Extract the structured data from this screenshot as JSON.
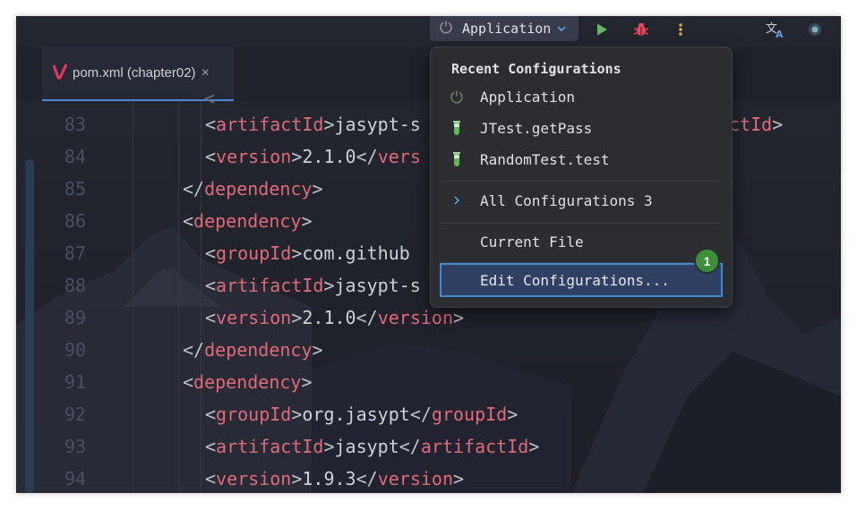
{
  "toolbar": {
    "run_config_label": "Application",
    "icons": [
      "power-icon",
      "chevron-down-icon",
      "run-icon",
      "debug-icon",
      "more-icon",
      "translate-icon",
      "status-icon"
    ]
  },
  "tab": {
    "title": "pom.xml (chapter02)",
    "close": "×"
  },
  "editor": {
    "line_numbers": [
      "83",
      "84",
      "85",
      "86",
      "87",
      "88",
      "89",
      "90",
      "91",
      "92",
      "93",
      "94"
    ],
    "lines": [
      {
        "indent": 2,
        "tag": "artifactId",
        "text": "jasypt-s",
        "close": "",
        "tail_right": "actId>"
      },
      {
        "indent": 2,
        "tag": "version",
        "text": "2.1.0",
        "close": "vers"
      },
      {
        "indent": 1,
        "closing": "dependency"
      },
      {
        "indent": 1,
        "opening": "dependency"
      },
      {
        "indent": 2,
        "tag": "groupId",
        "text": "com.github",
        "close": ""
      },
      {
        "indent": 2,
        "tag": "artifactId",
        "text": "jasypt-s",
        "close": ""
      },
      {
        "indent": 2,
        "tag": "version",
        "text": "2.1.0",
        "close": "version"
      },
      {
        "indent": 1,
        "closing": "dependency"
      },
      {
        "indent": 1,
        "opening": "dependency"
      },
      {
        "indent": 2,
        "tag": "groupId",
        "text": "org.jasypt",
        "close": "groupId"
      },
      {
        "indent": 2,
        "tag": "artifactId",
        "text": "jasypt",
        "close": "artifactId"
      },
      {
        "indent": 2,
        "tag": "version",
        "text": "1.9.3",
        "close": "version"
      }
    ]
  },
  "popup": {
    "header": "Recent Configurations",
    "recent": [
      {
        "label": "Application",
        "icon": "power-icon"
      },
      {
        "label": "JTest.getPass",
        "icon": "test-flask-icon"
      },
      {
        "label": "RandomTest.test",
        "icon": "test-flask-icon"
      }
    ],
    "all_configurations": "All Configurations 3",
    "current_file": "Current File",
    "edit_configurations": "Edit Configurations...",
    "badge": "1"
  },
  "colors": {
    "accent": "#3a8cd6",
    "tag": "#e0697a",
    "badge": "#3e8f3a",
    "run_green": "#5fb85b",
    "debug_red": "#e8485a"
  }
}
